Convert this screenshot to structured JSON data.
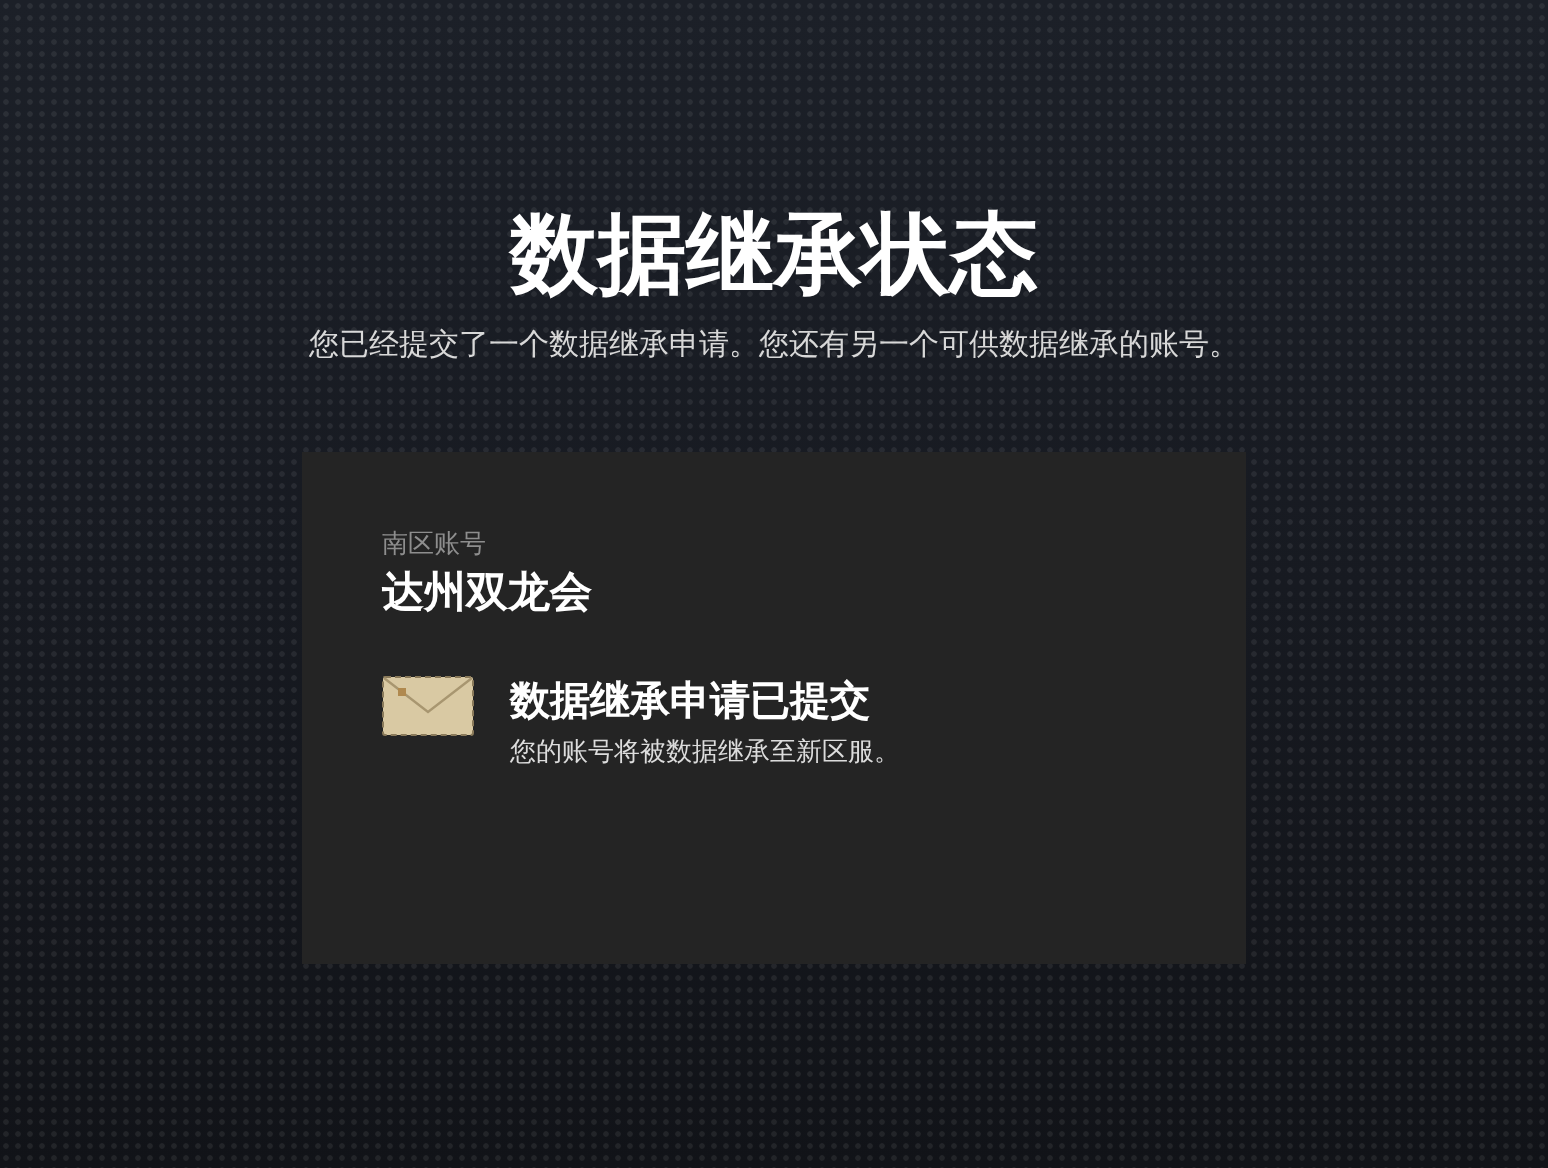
{
  "title": "数据继承状态",
  "subtitle": "您已经提交了一个数据继承申请。您还有另一个可供数据继承的账号。",
  "account": {
    "region_label": "南区账号",
    "name": "达州双龙会"
  },
  "status": {
    "kind": "submitted",
    "title": "数据继承申请已提交",
    "description": "您的账号将被数据继承至新区服。"
  }
}
